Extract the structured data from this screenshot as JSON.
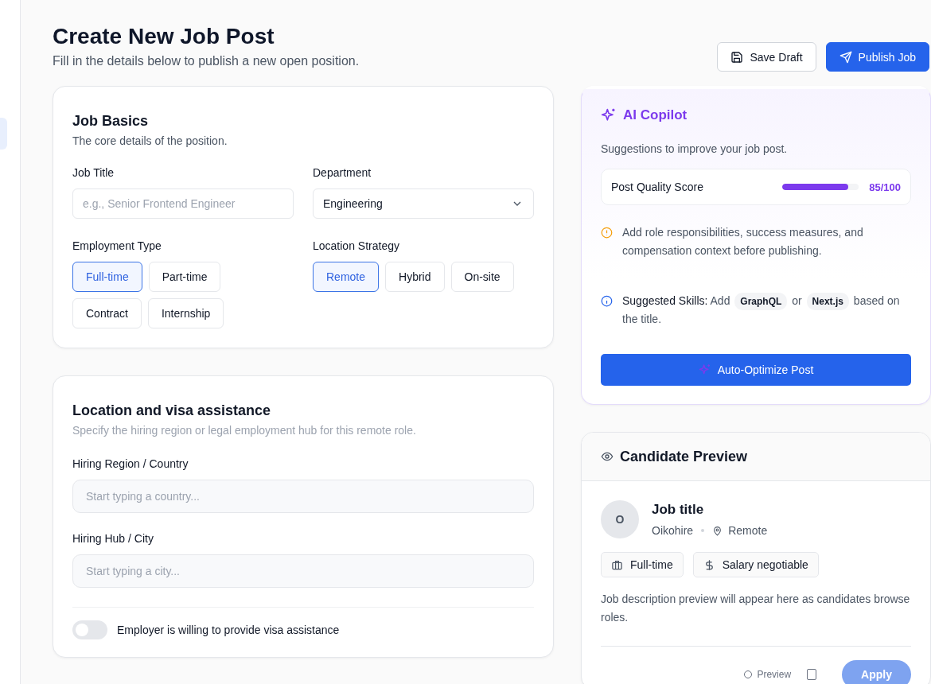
{
  "header": {
    "title": "Create New Job Post",
    "subtitle": "Fill in the details below to publish a new open position."
  },
  "actions": [
    {
      "kind": "secondary",
      "label": "Save Draft"
    },
    {
      "kind": "primary",
      "label": "Publish Job"
    }
  ],
  "job_basics": {
    "title": "Job Basics",
    "subtitle": "The core details of the position.",
    "job_title": {
      "label": "Job Title",
      "placeholder": "e.g., Senior Frontend Engineer"
    },
    "department": {
      "label": "Department",
      "value": "Engineering"
    },
    "employment_type": {
      "label": "Employment Type",
      "options": [
        {
          "label": "Full-time",
          "selected": true
        },
        {
          "label": "Part-time",
          "selected": false
        },
        {
          "label": "Contract",
          "selected": false
        },
        {
          "label": "Internship",
          "selected": false
        }
      ]
    },
    "location_strategy": {
      "label": "Location Strategy",
      "options": [
        {
          "label": "Remote",
          "selected": true
        },
        {
          "label": "Hybrid",
          "selected": false
        },
        {
          "label": "On-site",
          "selected": false
        }
      ]
    }
  },
  "location": {
    "title": "Location and visa assistance",
    "subtitle": "Specify the hiring region or legal employment hub for this remote role.",
    "region": {
      "label": "Hiring Region / Country",
      "placeholder": "Start typing a country..."
    },
    "city": {
      "label": "Hiring Hub / City",
      "placeholder": "Start typing a city..."
    },
    "visa": {
      "label": "Employer is willing to provide visa assistance",
      "on": false
    }
  },
  "copilot": {
    "title": "AI Copilot",
    "subtitle": "Suggestions to improve your job post.",
    "score": {
      "label": "Post Quality Score",
      "level": 0.86,
      "reading": "85/100"
    },
    "suggestions": [
      {
        "kind": "warning",
        "parts": [
          {
            "kind": "text",
            "text": "Add role responsibilities, success measures, and compensation context before publishing."
          }
        ]
      },
      {
        "kind": "info",
        "parts": [
          {
            "kind": "lead",
            "text": "Suggested Skills:"
          },
          {
            "kind": "text",
            "text": "Add"
          },
          {
            "kind": "chip",
            "text": "GraphQL"
          },
          {
            "kind": "text",
            "text": "or"
          },
          {
            "kind": "chip",
            "text": "Next.js"
          },
          {
            "kind": "text",
            "text": "based on"
          },
          {
            "kind": "text",
            "text": "the title."
          }
        ]
      }
    ],
    "button": "Auto-Optimize Post"
  },
  "preview": {
    "title": "Candidate Preview",
    "avatar": "O",
    "job_title": "Job title",
    "company": "Oikohire",
    "location": "Remote",
    "tags": [
      {
        "kind": "job",
        "label": "Full-time"
      },
      {
        "kind": "salary",
        "label": "Salary negotiable"
      }
    ],
    "description": "Job description preview will appear here as candidates browse roles.",
    "footer": {
      "preview_label": "Preview",
      "apply": {
        "label": "Apply",
        "disabled": true
      }
    }
  }
}
